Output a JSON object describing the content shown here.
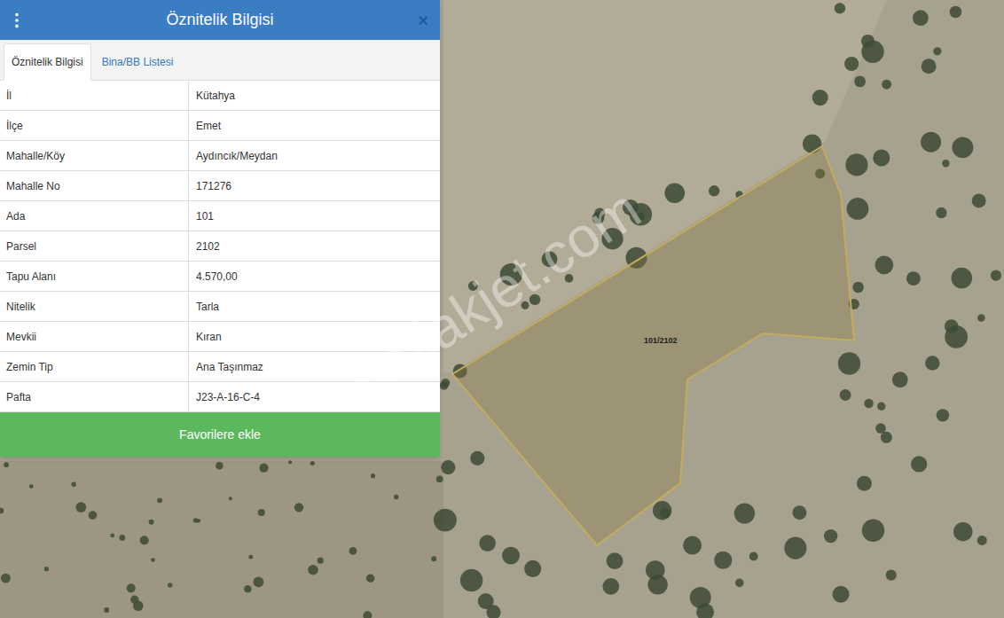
{
  "panel": {
    "title": "Öznitelik Bilgisi",
    "close": "×",
    "tabs": [
      {
        "label": "Öznitelik Bilgisi",
        "selected": true
      },
      {
        "label": "Bina/BB Listesi",
        "selected": false
      }
    ],
    "rows": [
      {
        "label": "İl",
        "value": "Kütahya"
      },
      {
        "label": "İlçe",
        "value": "Emet"
      },
      {
        "label": "Mahalle/Köy",
        "value": "Aydıncık/Meydan"
      },
      {
        "label": "Mahalle No",
        "value": "171276"
      },
      {
        "label": "Ada",
        "value": "101"
      },
      {
        "label": "Parsel",
        "value": "2102"
      },
      {
        "label": "Tapu Alanı",
        "value": "4.570,00"
      },
      {
        "label": "Nitelik",
        "value": "Tarla"
      },
      {
        "label": "Mevkii",
        "value": "Kıran"
      },
      {
        "label": "Zemin Tip",
        "value": "Ana Taşınmaz"
      },
      {
        "label": "Pafta",
        "value": "J23-A-16-C-4"
      }
    ],
    "button": "Favorilere ekle"
  },
  "map": {
    "parcel_label": "101/2102",
    "watermark": "emlakjet.com"
  }
}
